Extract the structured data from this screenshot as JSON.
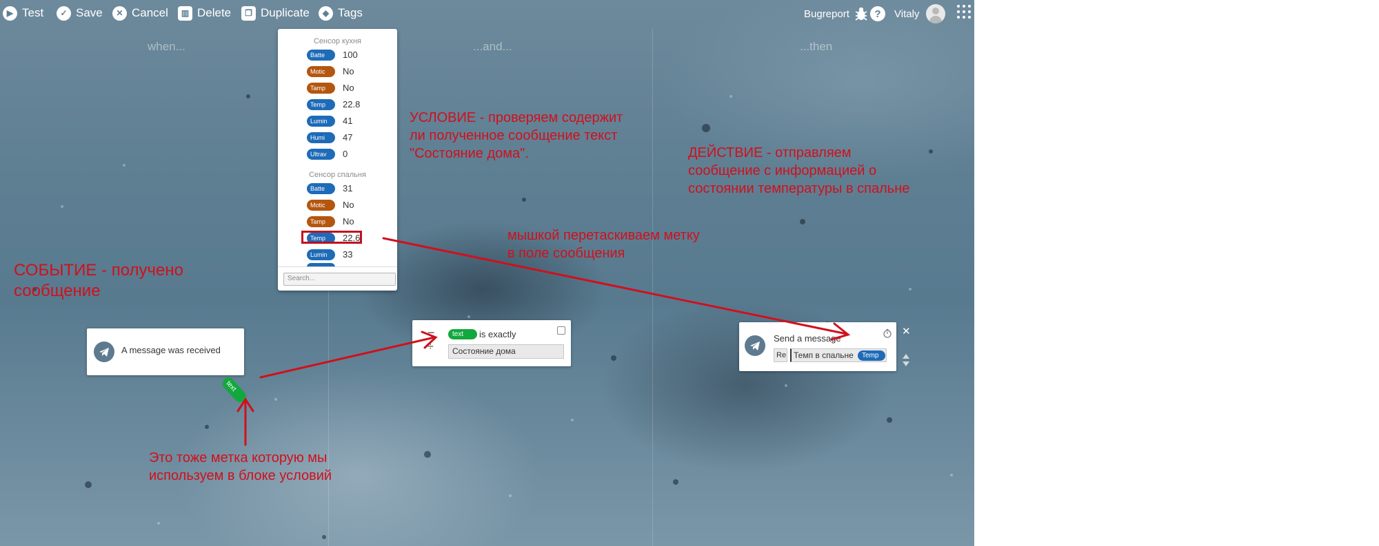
{
  "toolbar": {
    "test": "Test",
    "save": "Save",
    "cancel": "Cancel",
    "delete": "Delete",
    "duplicate": "Duplicate",
    "tags": "Tags",
    "bugreport": "Bugreport",
    "help": "?",
    "user": "Vitaly"
  },
  "columns": {
    "when": "when...",
    "and": "...and...",
    "then": "...then"
  },
  "tags_panel": {
    "group1": {
      "title": "Сенсор кухня",
      "tags": [
        {
          "name": "Batte",
          "value": "100",
          "kind": "number"
        },
        {
          "name": "Motic",
          "value": "No",
          "kind": "boolean"
        },
        {
          "name": "Tamp",
          "value": "No",
          "kind": "boolean"
        },
        {
          "name": "Temp",
          "value": "22.8",
          "kind": "number"
        },
        {
          "name": "Lumin",
          "value": "41",
          "kind": "number"
        },
        {
          "name": "Humi",
          "value": "47",
          "kind": "number"
        },
        {
          "name": "Ultrav",
          "value": "0",
          "kind": "number"
        }
      ]
    },
    "group2": {
      "title": "Сенсор спальня",
      "tags": [
        {
          "name": "Batte",
          "value": "31",
          "kind": "number"
        },
        {
          "name": "Motic",
          "value": "No",
          "kind": "boolean"
        },
        {
          "name": "Tamp",
          "value": "No",
          "kind": "boolean"
        },
        {
          "name": "Temp",
          "value": "22.6",
          "kind": "number"
        },
        {
          "name": "Lumin",
          "value": "33",
          "kind": "number"
        }
      ]
    },
    "search_placeholder": "Search..."
  },
  "event_block": {
    "label": "A message was received",
    "tag": "text"
  },
  "condition_block": {
    "tag": "text",
    "operator": "is exactly",
    "value": "Состояние дома"
  },
  "action_block": {
    "label": "Send a message",
    "field_prefix": "Re",
    "field_text": "Темп в спальне",
    "tag": "Temp"
  },
  "annotations": {
    "event_line1": "СОБЫТИЕ - получено",
    "event_line2": "сообщение",
    "condition_line1": "УСЛОВИЕ - проверяем содержит",
    "condition_line2": "ли полученное сообщение текст",
    "condition_line3": "\"Состояние дома\".",
    "action_line1": "ДЕЙСТВИЕ - отправляем",
    "action_line2": "сообщение с информацией о",
    "action_line3": "состоянии температуры в спальне",
    "drag_line1": "мышкой перетаскиваем метку",
    "drag_line2": "в поле сообщения",
    "tag_line1": "Это тоже метка которую мы",
    "tag_line2": "используем в блоке условий"
  },
  "colors": {
    "annotation": "#d0101c",
    "tag_number": "#1e6bb8",
    "tag_boolean": "#b4560f",
    "tag_text": "#13a83d"
  }
}
